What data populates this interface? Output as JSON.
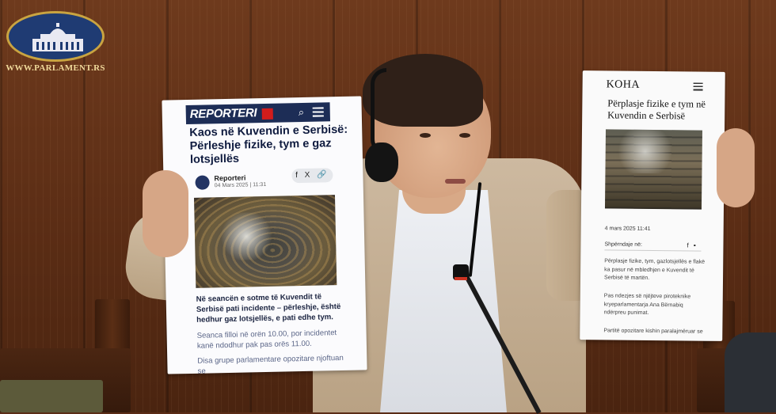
{
  "watermark": {
    "site": "WWW.PARLAMENT.RS"
  },
  "paper_left": {
    "brand": "REPORTERI",
    "search_icon": "⌕",
    "title": "Kaos në Kuvendin e Serbisë: Përleshje fizike, tym e gaz lotsjellës",
    "author": "Reporteri",
    "date": "04 Mars 2025 | 11:31",
    "share_icons": "f X 🔗",
    "lead": "Në seancën e sotme të Kuvendit të Serbisë pati incidente – përleshje, është hedhur gaz lotsjellës, e pati edhe tym.",
    "para2": "Seanca filloi në orën 10.00, por incidentet kanë ndodhur pak pas orës 11.00.",
    "para3": "Disa grupe parlamentare opozitare njoftuan se"
  },
  "paper_right": {
    "brand": "KOHA",
    "title": "Përplasje fizike e tym në Kuvendin e Serbisë",
    "date": "4 mars 2025 11:41",
    "share_label": "Shpërndaje në:",
    "share_icons": "f ▪",
    "para1": "Përplasje fizike, tym, gazlotsjellës e flakë ka pasur në mbledhjen e Kuvendit të Serbisë të martën.",
    "para2": "Pas ndezjes së njëjteve piroteknike kryeparlamentarja Ana Bërnabiq ndërpreu punimat.",
    "para3": "Partitë opozitare kishin paralajmëruar se"
  }
}
